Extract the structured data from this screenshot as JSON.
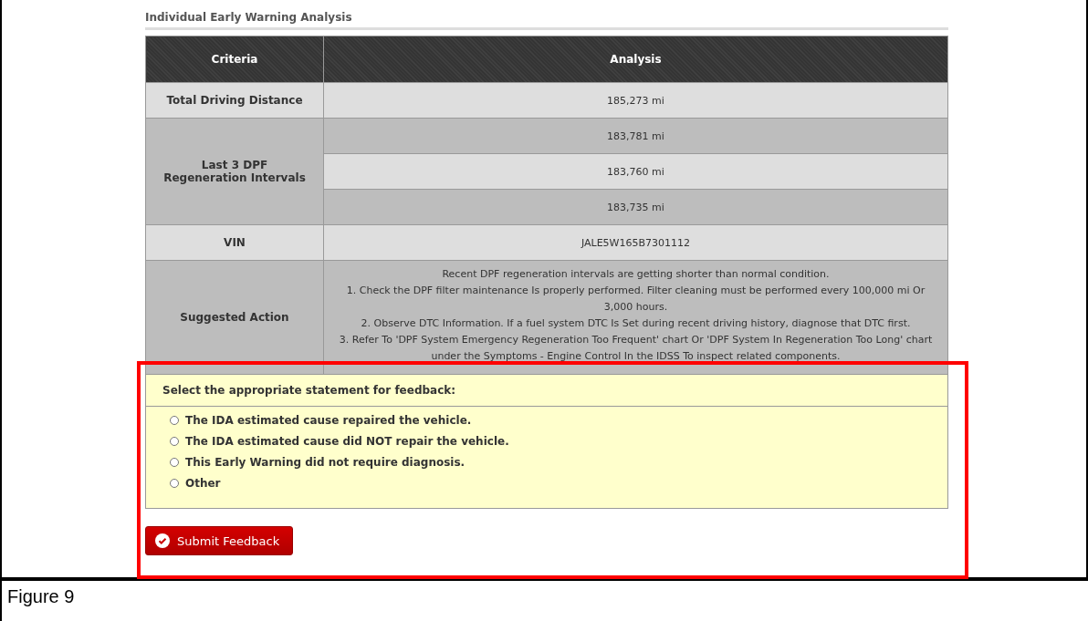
{
  "section_title": "Individual Early Warning Analysis",
  "table": {
    "columns": [
      "Criteria",
      "Analysis"
    ],
    "rows": [
      {
        "criteria": "Total Driving Distance",
        "values": [
          "185,273 mi"
        ]
      },
      {
        "criteria": "Last 3 DPF Regeneration Intervals",
        "values": [
          "183,781 mi",
          "183,760 mi",
          "183,735 mi"
        ]
      },
      {
        "criteria": "VIN",
        "values": [
          "JALE5W165B7301112"
        ]
      },
      {
        "criteria": "Suggested Action",
        "values": [
          "Recent DPF regeneration intervals are getting shorter than normal condition.",
          "1. Check the DPF filter maintenance Is properly performed. Filter cleaning must be performed every 100,000 mi Or 3,000 hours.",
          "2. Observe DTC Information. If a fuel system DTC Is Set during recent driving history, diagnose that DTC first.",
          "3. Refer To 'DPF System Emergency Regeneration Too Frequent' chart Or 'DPF System In Regeneration Too Long' chart under the Symptoms - Engine Control In the IDSS To inspect related components."
        ],
        "kind": "paragraph"
      }
    ]
  },
  "feedback": {
    "title": "Select the appropriate statement for feedback:",
    "options": [
      {
        "label": "The IDA estimated cause repaired the vehicle.",
        "selected": false
      },
      {
        "label": "The IDA estimated cause did NOT repair the vehicle.",
        "selected": false
      },
      {
        "label": "This Early Warning did not require diagnosis.",
        "selected": false
      },
      {
        "label": "Other",
        "selected": false
      }
    ]
  },
  "submit_button": "Submit Feedback",
  "caption": "Figure 9"
}
